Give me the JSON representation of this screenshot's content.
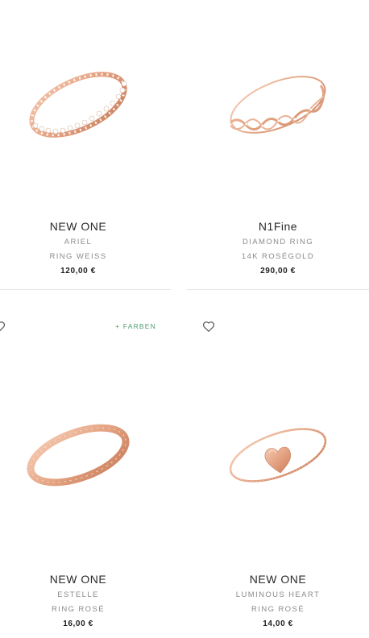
{
  "products": [
    {
      "brand": "NEW ONE",
      "line1": "ARIEL",
      "line2": "RING WEISS",
      "price": "120,00 €"
    },
    {
      "brand": "N1Fine",
      "line1": "DIAMOND RING",
      "line2": "14K ROSÉGOLD",
      "price": "290,00 €"
    },
    {
      "brand": "NEW ONE",
      "line1": "ESTELLE",
      "line2": "RING ROSÉ",
      "price": "16,00 €",
      "badge": "+ FARBEN"
    },
    {
      "brand": "NEW ONE",
      "line1": "LUMINOUS HEART",
      "line2": "RING ROSÉ",
      "price": "14,00 €"
    }
  ],
  "icons": {
    "wishlist": "heart-outline-icon"
  },
  "colors": {
    "rose_gold": "#e8a98a",
    "badge_green": "#4e9a6e",
    "divider": "#e4e4e4"
  }
}
